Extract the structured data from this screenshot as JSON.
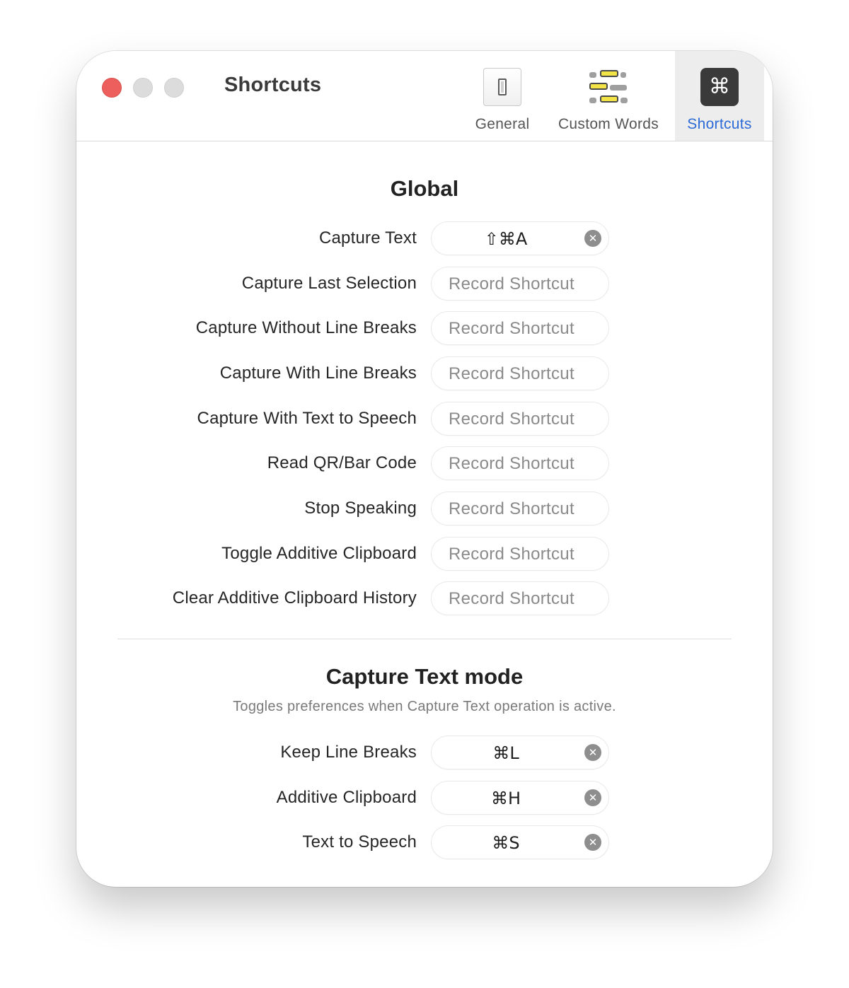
{
  "window": {
    "title": "Shortcuts"
  },
  "tabs": [
    {
      "label": "General",
      "icon": "light-switch-icon",
      "selected": false
    },
    {
      "label": "Custom Words",
      "icon": "word-list-icon",
      "selected": false
    },
    {
      "label": "Shortcuts",
      "icon": "command-key-icon",
      "icon_glyph": "⌘",
      "selected": true
    }
  ],
  "global": {
    "title": "Global",
    "rows": [
      {
        "label": "Capture Text",
        "shortcut": "⇧⌘A"
      },
      {
        "label": "Capture Last Selection",
        "placeholder": "Record Shortcut"
      },
      {
        "label": "Capture Without Line Breaks",
        "placeholder": "Record Shortcut"
      },
      {
        "label": "Capture With Line Breaks",
        "placeholder": "Record Shortcut"
      },
      {
        "label": "Capture With Text to Speech",
        "placeholder": "Record Shortcut"
      },
      {
        "label": "Read QR/Bar Code",
        "placeholder": "Record Shortcut"
      },
      {
        "label": "Stop Speaking",
        "placeholder": "Record Shortcut"
      },
      {
        "label": "Toggle Additive Clipboard",
        "placeholder": "Record Shortcut"
      },
      {
        "label": "Clear Additive Clipboard History",
        "placeholder": "Record Shortcut"
      }
    ]
  },
  "capture_mode": {
    "title": "Capture Text mode",
    "subtitle": "Toggles preferences when Capture Text operation is active.",
    "rows": [
      {
        "label": "Keep Line Breaks",
        "shortcut": "⌘L"
      },
      {
        "label": "Additive Clipboard",
        "shortcut": "⌘H"
      },
      {
        "label": "Text to Speech",
        "shortcut": "⌘S"
      }
    ]
  },
  "colors": {
    "accent": "#2c6bd6",
    "close": "#ec5f5d",
    "inactive_light": "#dcdcdc",
    "selected_tab_bg": "#ededed"
  },
  "clear_icon_glyph": "✕"
}
